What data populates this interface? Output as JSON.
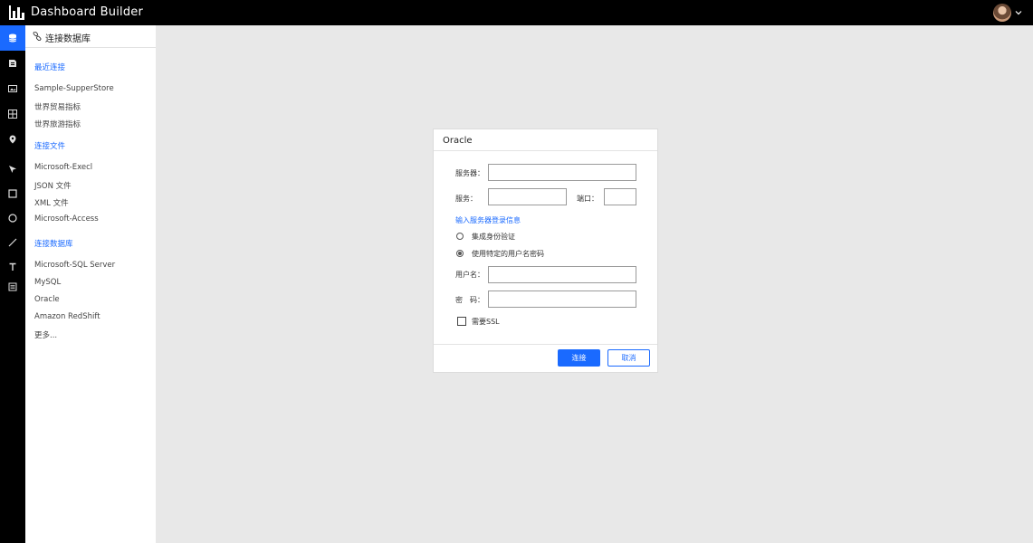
{
  "app": {
    "title": "Dashboard  Builder",
    "logo_icon": "bar-chart-logo-icon",
    "avatar": "user-avatar",
    "dropdown_icon": "chevron-down-icon"
  },
  "rail": {
    "items": [
      {
        "icon": "database-icon",
        "active": true
      },
      {
        "icon": "file-icon",
        "active": false
      },
      {
        "icon": "image-icon",
        "active": false
      },
      {
        "icon": "table-icon",
        "active": false
      },
      {
        "icon": "map-pin-icon",
        "active": false
      },
      {
        "icon": "cursor-icon",
        "active": false
      },
      {
        "icon": "square-icon",
        "active": false
      },
      {
        "icon": "circle-icon",
        "active": false
      },
      {
        "icon": "line-icon",
        "active": false
      },
      {
        "icon": "text-icon",
        "active": false
      },
      {
        "icon": "list-icon",
        "active": false
      }
    ]
  },
  "panel": {
    "title": "连接数据库",
    "icon": "link-icon",
    "sections": [
      {
        "title": "最近连接",
        "items": [
          "Sample-SupperStore",
          "世界贸易指标",
          "世界旅游指标"
        ]
      },
      {
        "title": "连接文件",
        "items": [
          "Microsoft-Execl",
          "JSON 文件",
          "XML 文件",
          "Microsoft-Access"
        ]
      },
      {
        "title": "连接数据库",
        "items": [
          "Microsoft-SQL Server",
          "MySQL",
          "Oracle",
          "Amazon RedShift",
          "更多..."
        ]
      }
    ]
  },
  "dialog": {
    "title": "Oracle",
    "server_label": "服务器：",
    "server_value": "",
    "service_label": "服务：",
    "service_value": "",
    "port_label": "端口：",
    "port_value": "",
    "login_info_label": "输入服务器登录信息",
    "auth_options": [
      {
        "label": "集成身份验证",
        "checked": false
      },
      {
        "label": "使用特定的用户名密码",
        "checked": true
      }
    ],
    "username_label": "用户名：",
    "username_value": "",
    "password_label": "密　码：",
    "password_value": "",
    "ssl_label": "需要SSL",
    "ssl_checked": false,
    "connect_button": "连接",
    "cancel_button": "取消"
  },
  "colors": {
    "accent": "#1a6aff",
    "topbar": "#000000",
    "canvas": "#e8e8e8"
  }
}
